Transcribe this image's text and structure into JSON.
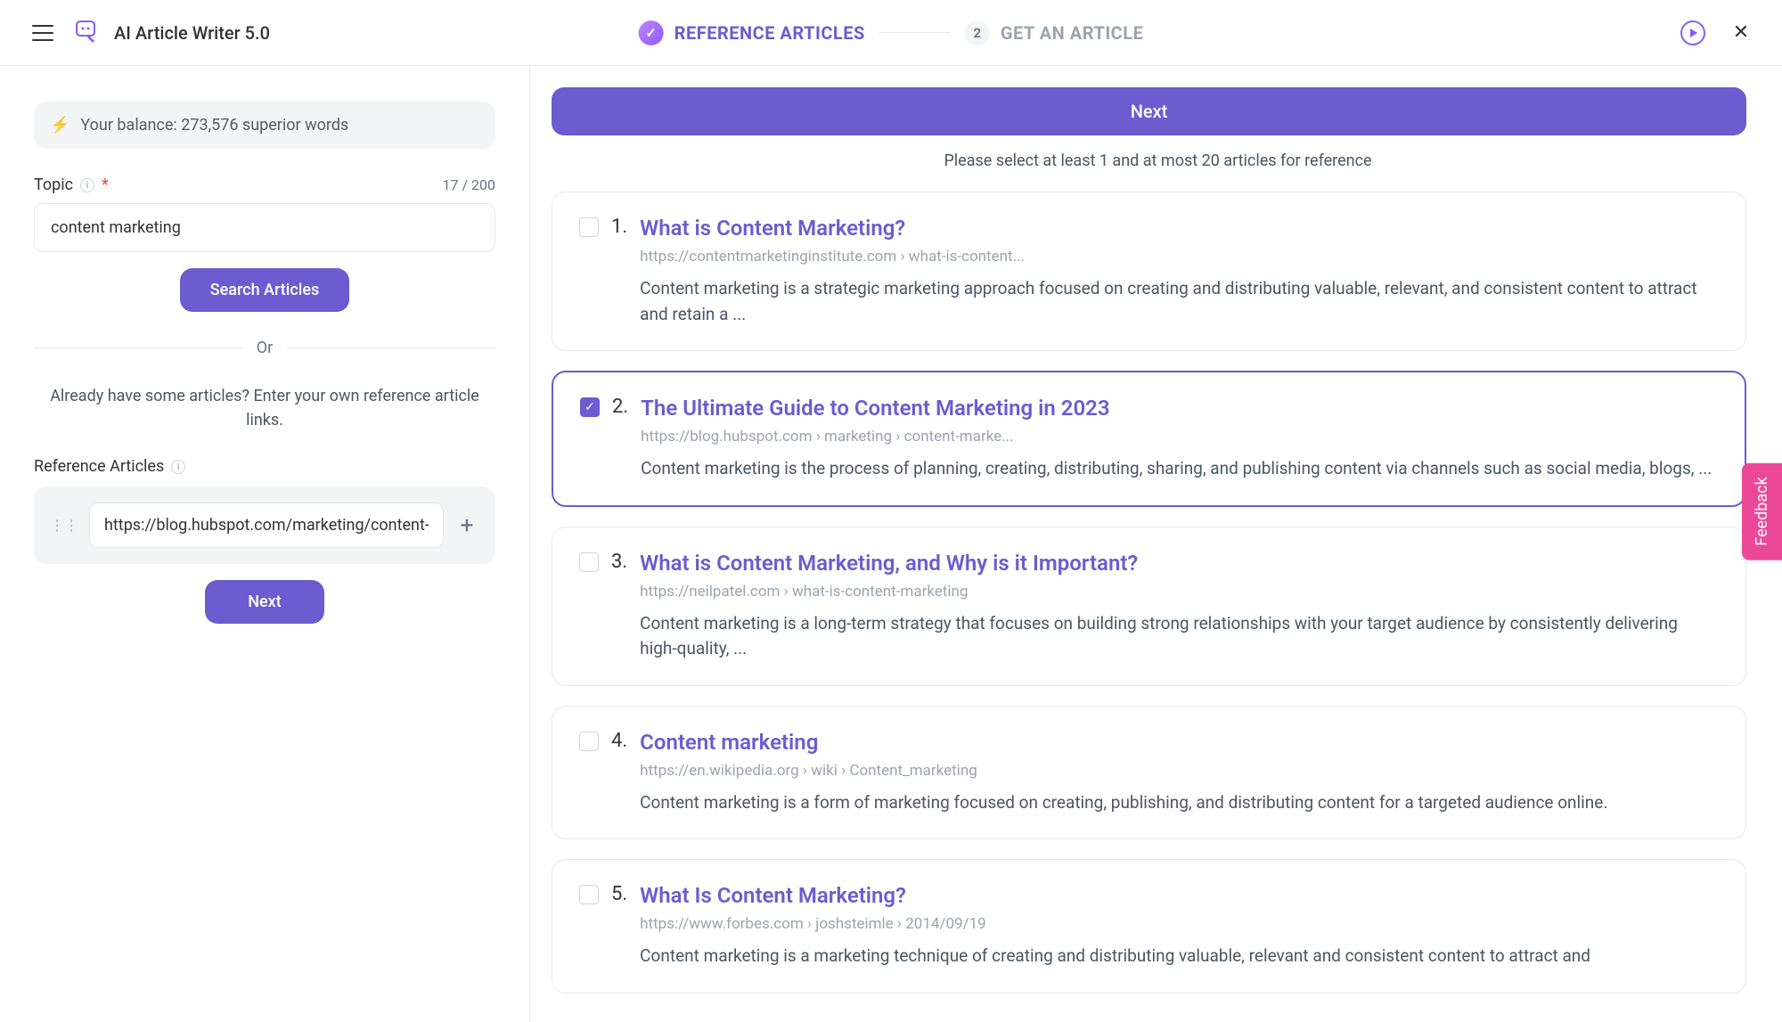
{
  "header": {
    "app_title": "AI Article Writer 5.0",
    "step1_label": "REFERENCE ARTICLES",
    "step2_num": "2",
    "step2_label": "GET AN ARTICLE"
  },
  "sidebar": {
    "balance_text": "Your balance: 273,576 superior words",
    "topic_label": "Topic",
    "topic_count": "17 / 200",
    "topic_value": "content marketing",
    "search_btn": "Search Articles",
    "or_text": "Or",
    "already_text": "Already have some articles? Enter your own reference article links.",
    "ref_label": "Reference Articles",
    "ref_value": "https://blog.hubspot.com/marketing/content-marketing",
    "next_btn": "Next"
  },
  "content": {
    "next_btn": "Next",
    "help_text": "Please select at least 1 and at most 20 articles for reference",
    "articles": [
      {
        "num": "1.",
        "title": "What is Content Marketing?",
        "url": "https://contentmarketinginstitute.com › what-is-content...",
        "snippet": "Content marketing is a strategic marketing approach focused on creating and distributing valuable, relevant, and consistent content to attract and retain a ...",
        "selected": false
      },
      {
        "num": "2.",
        "title": "The Ultimate Guide to Content Marketing in 2023",
        "url": "https://blog.hubspot.com › marketing › content-marke...",
        "snippet": "Content marketing is the process of planning, creating, distributing, sharing, and publishing content via channels such as social media, blogs, ...",
        "selected": true
      },
      {
        "num": "3.",
        "title": "What is Content Marketing, and Why is it Important?",
        "url": "https://neilpatel.com › what-is-content-marketing",
        "snippet": "Content marketing is a long-term strategy that focuses on building strong relationships with your target audience by consistently delivering high-quality, ...",
        "selected": false
      },
      {
        "num": "4.",
        "title": "Content marketing",
        "url": "https://en.wikipedia.org › wiki › Content_marketing",
        "snippet": "Content marketing is a form of marketing focused on creating, publishing, and distributing content for a targeted audience online.",
        "selected": false
      },
      {
        "num": "5.",
        "title": "What Is Content Marketing?",
        "url": "https://www.forbes.com › joshsteimle › 2014/09/19",
        "snippet": "Content marketing is a marketing technique of creating and distributing valuable, relevant and consistent content to attract and",
        "selected": false
      }
    ]
  },
  "feedback_label": "Feedback"
}
